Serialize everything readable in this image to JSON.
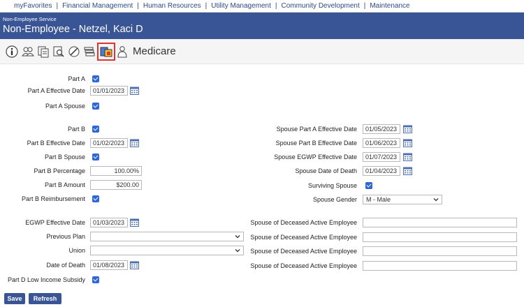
{
  "topnav": {
    "items": [
      "myFavorites",
      "Financial Management",
      "Human Resources",
      "Utility Management",
      "Community Development",
      "Maintenance"
    ],
    "separator": "|"
  },
  "header": {
    "subtitle": "Non-Employee Service",
    "title": "Non-Employee -  Netzel, Kaci D"
  },
  "toolbar": {
    "title": "Medicare",
    "icons": [
      "info-icon",
      "group-icon",
      "copy-icon",
      "search-document-icon",
      "edit-icon",
      "stack-icon",
      "medicare-icon",
      "person-icon"
    ],
    "selected_icon": "medicare-icon"
  },
  "left": {
    "part_a_label": "Part A",
    "part_a_checked": true,
    "part_a_eff_label": "Part A Effective Date",
    "part_a_eff_value": "01/01/2023",
    "part_a_spouse_label": "Part A Spouse",
    "part_a_spouse_checked": true,
    "part_b_label": "Part B",
    "part_b_checked": true,
    "part_b_eff_label": "Part B Effective Date",
    "part_b_eff_value": "01/02/2023",
    "part_b_spouse_label": "Part B Spouse",
    "part_b_spouse_checked": true,
    "part_b_pct_label": "Part B Percentage",
    "part_b_pct_value": "100.00%",
    "part_b_amt_label": "Part B Amount",
    "part_b_amt_value": "$200.00",
    "part_b_reimb_label": "Part B Reimbursement",
    "part_b_reimb_checked": true,
    "egwp_label": "EGWP Effective Date",
    "egwp_value": "01/03/2023",
    "prev_plan_label": "Previous Plan",
    "prev_plan_value": "",
    "union_label": "Union",
    "union_value": "",
    "dod_label": "Date of Death",
    "dod_value": "01/08/2023",
    "part_d_label": "Part D Low Income Subsidy",
    "part_d_checked": true
  },
  "right": {
    "sp_a_eff_label": "Spouse Part A Effective Date",
    "sp_a_eff_value": "01/05/2023",
    "sp_b_eff_label": "Spouse Part B Effective Date",
    "sp_b_eff_value": "01/06/2023",
    "sp_egwp_label": "Spouse EGWP Effective Date",
    "sp_egwp_value": "01/07/2023",
    "sp_dod_label": "Spouse Date of Death",
    "sp_dod_value": "01/04/2023",
    "surviving_label": "Surviving Spouse",
    "surviving_checked": true,
    "gender_label": "Spouse Gender",
    "gender_value": "M - Male",
    "deceased_label_1": "Spouse of Deceased Active Employee",
    "deceased_label_2": "Spouse of Deceased Active Employee",
    "deceased_label_3": "Spouse of Deceased Active Employee",
    "deceased_label_4": "Spouse of Deceased Active Employee",
    "deceased_value_1": "",
    "deceased_value_2": "",
    "deceased_value_3": "",
    "deceased_value_4": ""
  },
  "buttons": {
    "save": "Save",
    "refresh": "Refresh"
  },
  "colors": {
    "header_bg": "#3a5596",
    "checkbox": "#2f67d8",
    "selected_outline": "#e23333",
    "nav_link": "#2b4a8a"
  }
}
